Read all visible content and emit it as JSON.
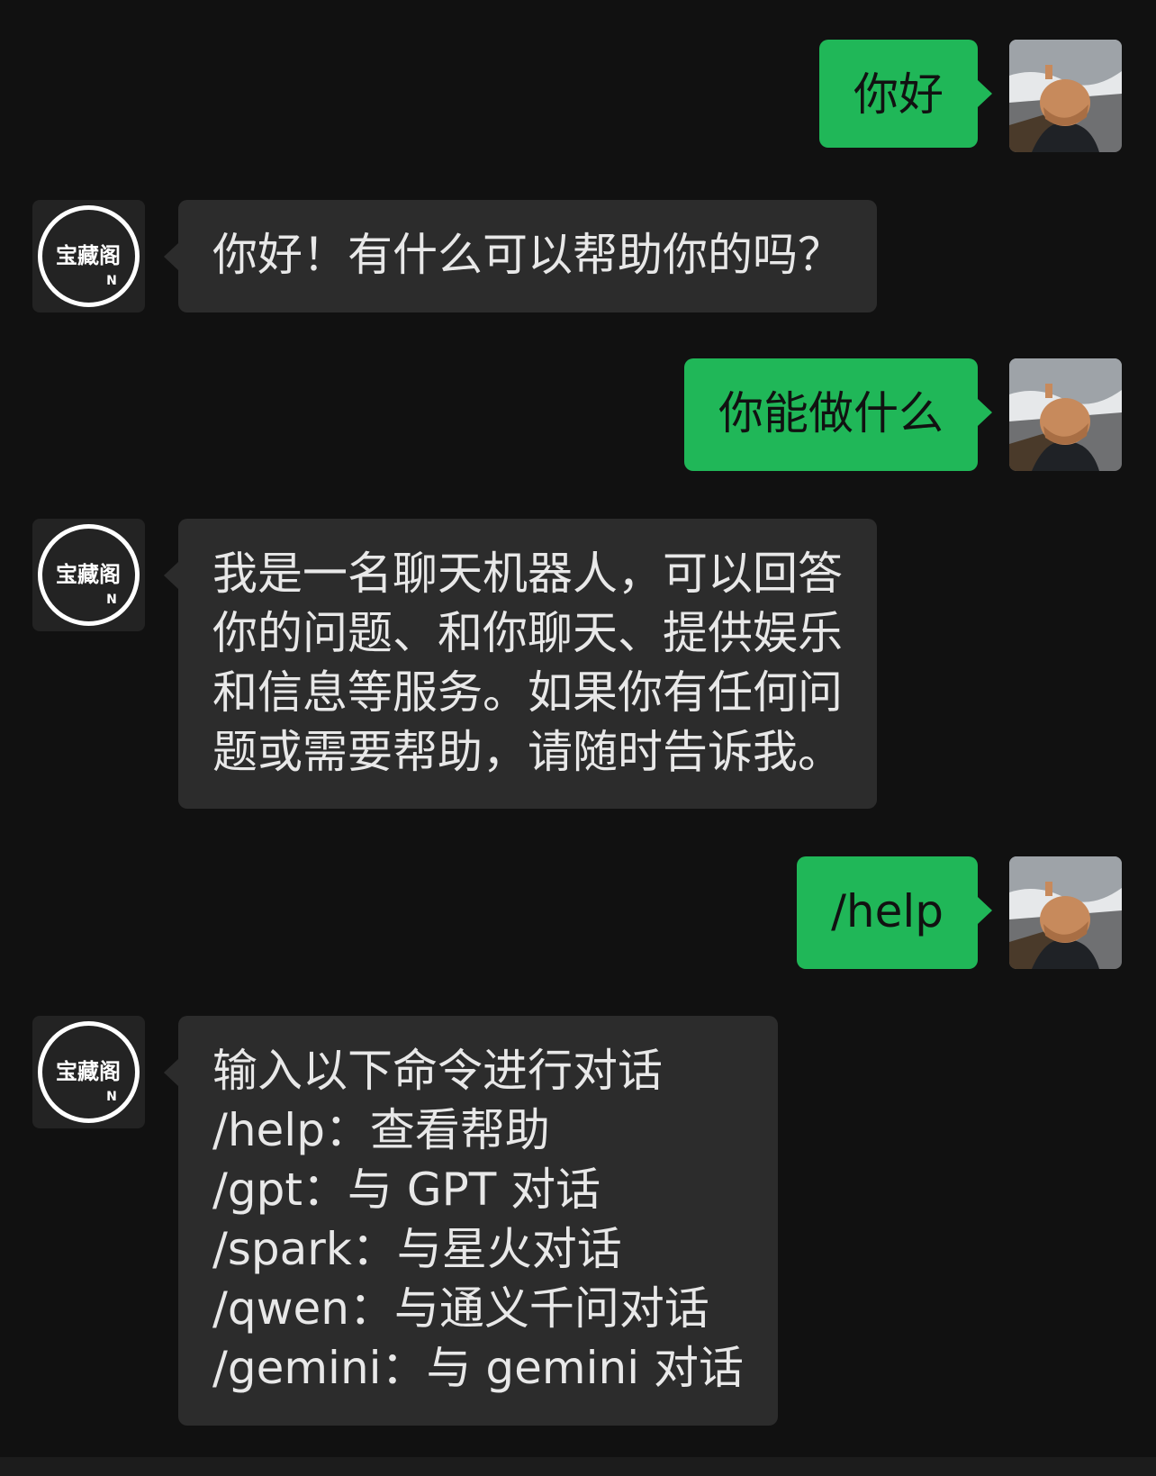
{
  "colors": {
    "background": "#111111",
    "user_bubble": "#20b758",
    "bot_bubble": "#2c2c2c",
    "bot_text": "#e8e8e8",
    "user_text": "#111111"
  },
  "bot": {
    "logo_text": "宝藏阁",
    "logo_subtext": "N",
    "avatar_icon": "treasure-pavilion-logo-icon"
  },
  "user": {
    "avatar_icon": "user-photo-cap-icon"
  },
  "messages": [
    {
      "sender": "user",
      "text": "你好"
    },
    {
      "sender": "bot",
      "text": "你好！有什么可以帮助你的吗？"
    },
    {
      "sender": "user",
      "text": "你能做什么"
    },
    {
      "sender": "bot",
      "text": "我是一名聊天机器人，可以回答\n你的问题、和你聊天、提供娱乐\n和信息等服务。如果你有任何问\n题或需要帮助，请随时告诉我。"
    },
    {
      "sender": "user",
      "text": "/help"
    },
    {
      "sender": "bot",
      "text": "输入以下命令进行对话\n/help：查看帮助\n/gpt：与 GPT 对话\n/spark：与星火对话\n/qwen：与通义千问对话\n/gemini：与 gemini 对话"
    }
  ]
}
